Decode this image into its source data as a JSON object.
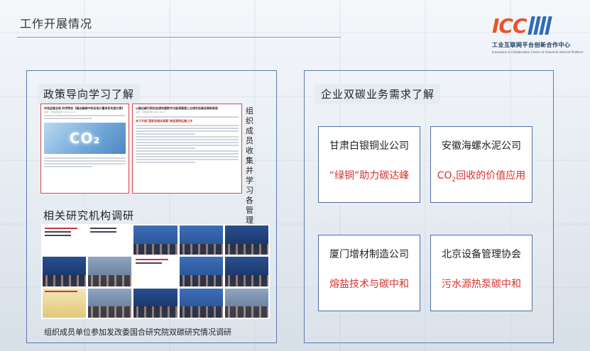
{
  "header": {
    "title": "工作开展情况"
  },
  "logo": {
    "mark": "ICC",
    "cn": "工业互联网平台创新合作中心",
    "en": "Innovation & Collaboration Center of Industrial Internet Platform"
  },
  "left_panel": {
    "policy_tag": "政策导向学习了解",
    "doc1": {
      "title": "市场监管总局 科学院在《碳达峰碳中和标准计量体系实施方案》",
      "sub": "来源：市场监管总局 2022-10-31",
      "image_text": "CO₂"
    },
    "doc2": {
      "title": "以碳达峰为契机加速构建数字化能源管理工业绿色低碳发展新格局",
      "sub": "来源：中国经济网 2022-06-17",
      "red_title": "关于开展\"国家发展改革委\"典型案例征集工作"
    },
    "vertical_note": "组织成员收集并学习各管理部门相关政策",
    "research_tag": "相关研究机构调研",
    "caption": "组织成员单位参加发改委国合研究院双碳研究情况调研"
  },
  "right_panel": {
    "tag": "企业双碳业务需求了解",
    "cards": [
      {
        "name": "甘肃白银铜业公司",
        "sub": "“绿铜”助力碳达峰"
      },
      {
        "name": "安徽海螺水泥公司",
        "sub_pre": "CO",
        "sub_subscript": "2",
        "sub_post": "回收的价值应用"
      },
      {
        "name": "厦门增材制造公司",
        "sub": "熔盐技术与碳中和"
      },
      {
        "name": "北京设备管理协会",
        "sub": "污水源热泵碳中和"
      }
    ]
  },
  "colors": {
    "accent_red": "#d9302c",
    "frame_blue": "#4f6ea0",
    "logo_orange": "#e8532d",
    "logo_blue": "#2f6cb5"
  }
}
